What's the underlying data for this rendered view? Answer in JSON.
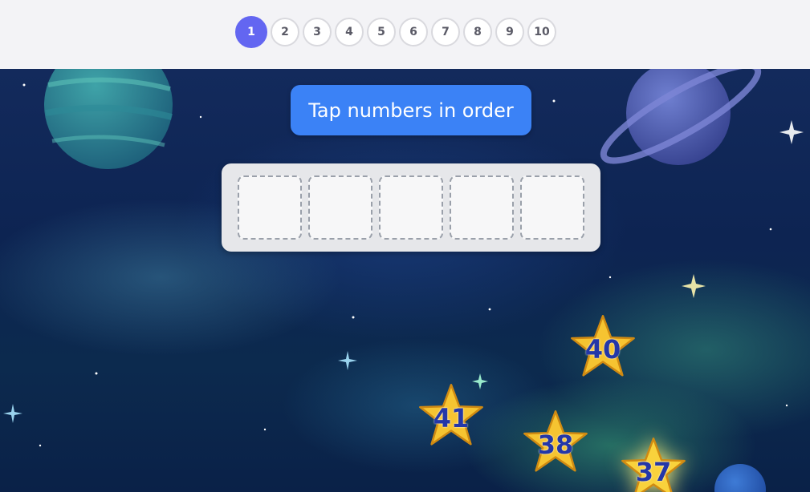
{
  "levels": {
    "items": [
      "1",
      "2",
      "3",
      "4",
      "5",
      "6",
      "7",
      "8",
      "9",
      "10"
    ],
    "active_index": 0
  },
  "banner": {
    "text": "Tap numbers in order"
  },
  "answer_slots": {
    "count": 5
  },
  "stars": [
    {
      "label": "40"
    },
    {
      "label": "41"
    },
    {
      "label": "38"
    },
    {
      "label": "37",
      "highlighted": true
    }
  ],
  "colors": {
    "active_level": "#6366f1",
    "banner": "#3b82f6",
    "star_fill": "#f6c431",
    "star_number": "#2437a8"
  }
}
